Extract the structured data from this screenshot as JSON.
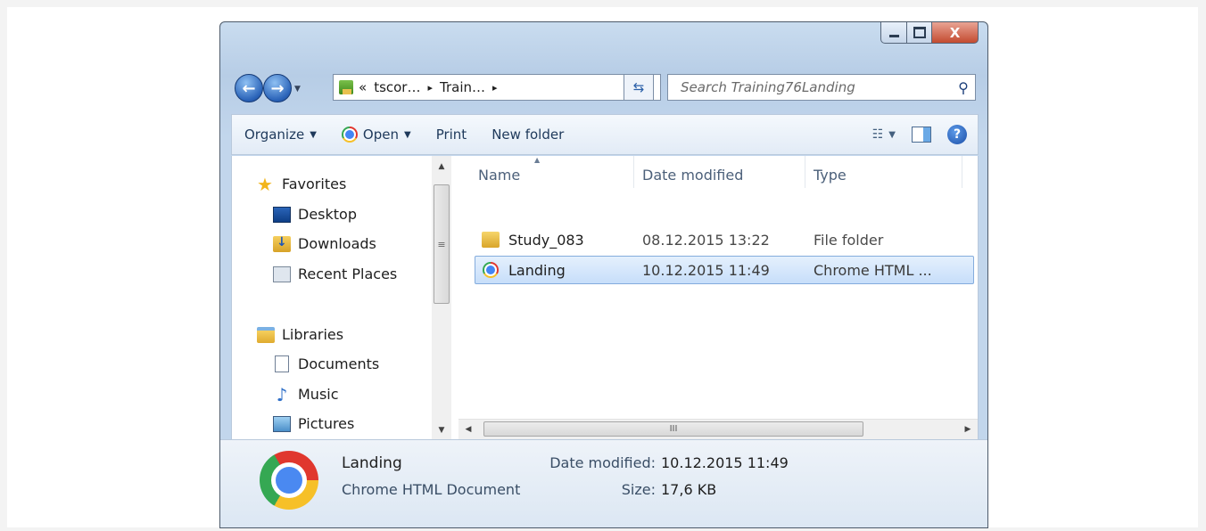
{
  "window": {
    "caption": {
      "close": "X"
    },
    "address": {
      "crumbs": [
        "«",
        "tscor…",
        "▸",
        "Train…",
        "▸"
      ]
    },
    "search": {
      "placeholder": "Search Training76Landing"
    }
  },
  "toolbar": {
    "organize": "Organize",
    "open": "Open",
    "print": "Print",
    "new_folder": "New folder"
  },
  "nav": {
    "favorites": "Favorites",
    "desktop": "Desktop",
    "downloads": "Downloads",
    "recent_places": "Recent Places",
    "libraries": "Libraries",
    "documents": "Documents",
    "music": "Music",
    "pictures": "Pictures"
  },
  "columns": {
    "name": "Name",
    "date": "Date modified",
    "type": "Type"
  },
  "files": [
    {
      "name": "Study_083",
      "date": "08.12.2015 13:22",
      "type": "File folder",
      "icon": "folder-icon"
    },
    {
      "name": "Landing",
      "date": "10.12.2015 11:49",
      "type": "Chrome HTML ...",
      "icon": "chrome-icon",
      "selected": true
    }
  ],
  "details": {
    "name": "Landing",
    "type": "Chrome HTML Document",
    "date_label": "Date modified:",
    "date_value": "10.12.2015 11:49",
    "size_label": "Size:",
    "size_value": "17,6 KB"
  },
  "colors": {
    "accent": "#2a63b8",
    "selection": "#c7defa",
    "chrome_red": "#e0372e",
    "chrome_yellow": "#f6c028",
    "chrome_green": "#35a853",
    "chrome_blue": "#4285f4"
  }
}
